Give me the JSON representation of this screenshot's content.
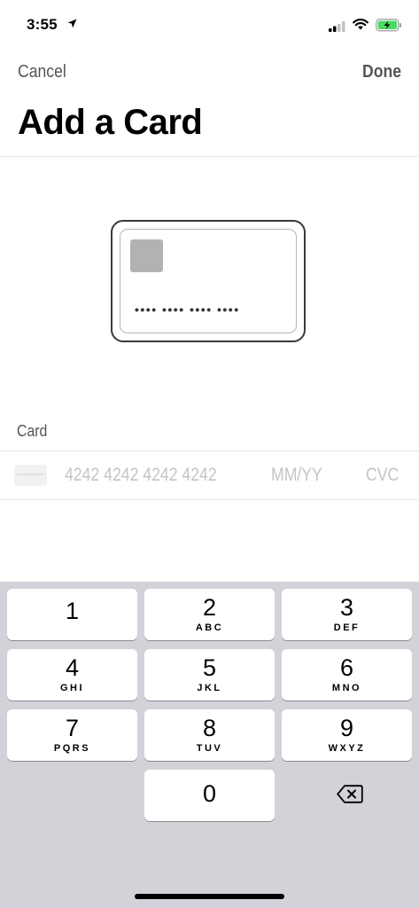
{
  "status_bar": {
    "time": "3:55"
  },
  "nav": {
    "cancel_label": "Cancel",
    "done_label": "Done"
  },
  "title": "Add a Card",
  "card_illustration": {
    "number_mask": "•••• •••• •••• ••••"
  },
  "form": {
    "section_label": "Card",
    "card_number_placeholder": "4242 4242 4242 4242",
    "expiry_placeholder": "MM/YY",
    "cvc_placeholder": "CVC"
  },
  "keyboard": {
    "keys": [
      {
        "digit": "1",
        "letters": ""
      },
      {
        "digit": "2",
        "letters": "ABC"
      },
      {
        "digit": "3",
        "letters": "DEF"
      },
      {
        "digit": "4",
        "letters": "GHI"
      },
      {
        "digit": "5",
        "letters": "JKL"
      },
      {
        "digit": "6",
        "letters": "MNO"
      },
      {
        "digit": "7",
        "letters": "PQRS"
      },
      {
        "digit": "8",
        "letters": "TUV"
      },
      {
        "digit": "9",
        "letters": "WXYZ"
      },
      {
        "digit": "0",
        "letters": ""
      }
    ],
    "backspace_icon": "delete-backward-icon"
  },
  "colors": {
    "keyboard_bg": "#d1d3d9",
    "key_bg": "#ffffff",
    "battery_green": "#4cd964",
    "placeholder": "#c4c4c4"
  }
}
